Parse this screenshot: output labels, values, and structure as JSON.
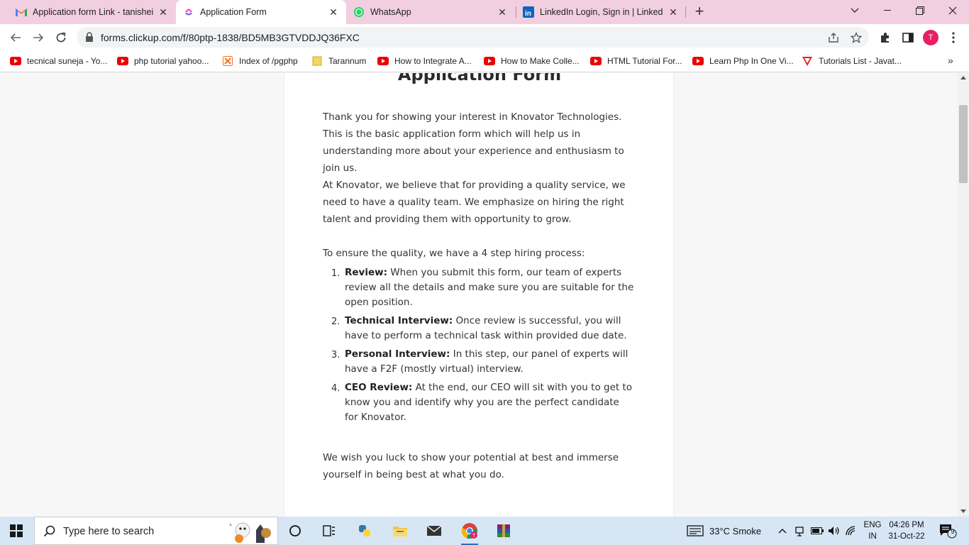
{
  "browser": {
    "tabs": [
      {
        "title": "Application form Link - tanisheik",
        "icon": "gmail-icon"
      },
      {
        "title": "Application Form",
        "icon": "clickup-icon"
      },
      {
        "title": "WhatsApp",
        "icon": "whatsapp-icon"
      },
      {
        "title": "LinkedIn Login, Sign in | LinkedIn",
        "icon": "linkedin-icon"
      }
    ],
    "active_tab": 1,
    "url": "forms.clickup.com/f/80ptp-1838/BD5MB3GTVDDJQ36FXC",
    "profile_initial": "T"
  },
  "bookmarks": [
    {
      "label": "tecnical suneja - Yo...",
      "icon": "youtube-icon"
    },
    {
      "label": "php tutorial yahoo...",
      "icon": "youtube-icon"
    },
    {
      "label": "Index of /pgphp",
      "icon": "xampp-icon"
    },
    {
      "label": "Tarannum",
      "icon": "folder-icon"
    },
    {
      "label": "How to Integrate A...",
      "icon": "youtube-icon"
    },
    {
      "label": "How to Make Colle...",
      "icon": "youtube-icon"
    },
    {
      "label": "HTML Tutorial For...",
      "icon": "youtube-icon"
    },
    {
      "label": "Learn Php In One Vi...",
      "icon": "youtube-icon"
    },
    {
      "label": "Tutorials List - Javat...",
      "icon": "javatpoint-icon"
    }
  ],
  "form": {
    "title": "Application Form",
    "intro": "Thank you for showing your interest in Knovator Technologies. This is the basic application form which will help us in understanding more about your experience and enthusiasm to join us.",
    "belief": "At Knovator, we believe that for providing a quality service, we need to have a quality team. We emphasize on hiring the right talent and providing them with opportunity to grow.",
    "process_intro": "To ensure the quality, we have a 4 step hiring process:",
    "steps": [
      {
        "num": "1.",
        "title": "Review:",
        "text": " When you submit this form, our team of experts review all the details and make sure you are suitable for the open position."
      },
      {
        "num": "2.",
        "title": "Technical Interview:",
        "text": " Once review is successful, you will have to perform a technical task within provided due date."
      },
      {
        "num": "3.",
        "title": "Personal Interview:",
        "text": " In this step, our panel of experts will have a F2F (mostly virtual) interview."
      },
      {
        "num": "4.",
        "title": "CEO Review:",
        "text": " At the end, our CEO will sit with you to get to know you and identify why you are the perfect candidate for Knovator."
      }
    ],
    "closing": "We wish you luck to show your potential at best and immerse yourself in being best at what you do."
  },
  "taskbar": {
    "search_placeholder": "Type here to search",
    "weather": "33°C  Smoke",
    "lang_line1": "ENG",
    "lang_line2": "IN",
    "time": "04:26 PM",
    "date": "31-Oct-22",
    "notification_count": "9"
  },
  "colors": {
    "tabstrip": "#f2cfe0",
    "taskbar": "#d6e6f5",
    "accent": "#e91e63"
  }
}
